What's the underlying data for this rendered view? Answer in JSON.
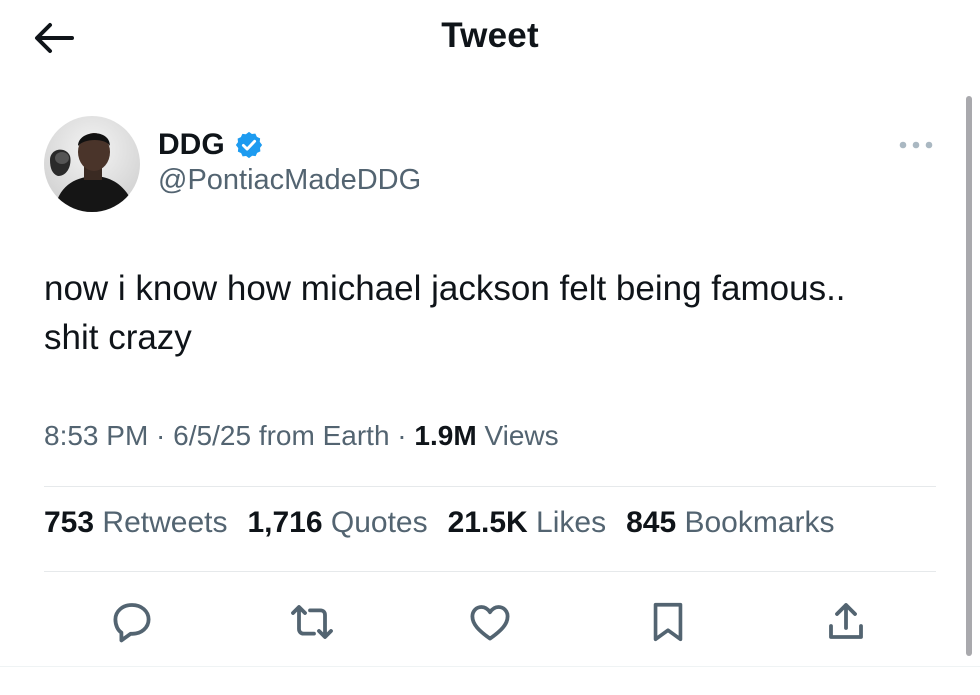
{
  "header": {
    "title": "Tweet",
    "back_icon": "arrow-left-icon"
  },
  "tweet": {
    "author": {
      "display_name": "DDG",
      "handle": "@PontiacMadeDDG",
      "verified_icon": "verified-badge-icon",
      "verified_color": "#1d9bf0"
    },
    "more_icon": "more-horizontal-icon",
    "text": "now i know how michael jackson felt being famous..\nshit crazy",
    "time": "8:53 PM",
    "date": "6/5/25",
    "source": "from Earth",
    "views_count": "1.9M",
    "views_label": "Views"
  },
  "stats": [
    {
      "count": "753",
      "label": "Retweets"
    },
    {
      "count": "1,716",
      "label": "Quotes"
    },
    {
      "count": "21.5K",
      "label": "Likes"
    },
    {
      "count": "845",
      "label": "Bookmarks"
    }
  ],
  "actions": [
    {
      "icon": "reply-icon"
    },
    {
      "icon": "retweet-icon"
    },
    {
      "icon": "like-heart-icon"
    },
    {
      "icon": "bookmark-icon"
    },
    {
      "icon": "share-icon"
    }
  ],
  "colors": {
    "text_primary": "#0f1419",
    "text_secondary": "#536471",
    "icon": "#536471",
    "divider": "#e6e9eb"
  }
}
